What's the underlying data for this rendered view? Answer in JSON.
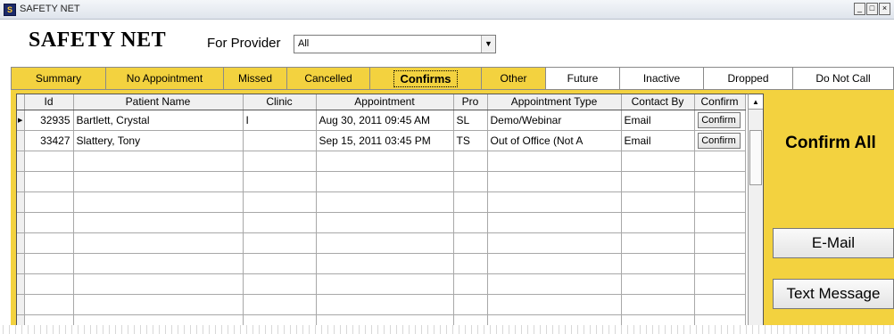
{
  "window": {
    "title": "SAFETY NET",
    "controls": [
      "_",
      "□",
      "×"
    ]
  },
  "header": {
    "app_title": "SAFETY NET",
    "provider_label": "For Provider",
    "provider_value": "All"
  },
  "tabs": [
    {
      "label": "Summary",
      "style": "yellow"
    },
    {
      "label": "No Appointment",
      "style": "yellow"
    },
    {
      "label": "Missed",
      "style": "yellow"
    },
    {
      "label": "Cancelled",
      "style": "yellow"
    },
    {
      "label": "Confirms",
      "style": "active"
    },
    {
      "label": "Other",
      "style": "yellow"
    },
    {
      "label": "Future",
      "style": "white"
    },
    {
      "label": "Inactive",
      "style": "white"
    },
    {
      "label": "Dropped",
      "style": "white"
    },
    {
      "label": "Do Not Call",
      "style": "white"
    }
  ],
  "grid": {
    "columns": [
      "Id",
      "Patient Name",
      "Clinic",
      "Appointment",
      "Pro",
      "Appointment Type",
      "Contact By",
      "Confirm"
    ],
    "rows": [
      {
        "id": "32935",
        "patient": "Bartlett, Crystal",
        "clinic": "I",
        "appointment": "Aug 30, 2011 09:45 AM",
        "pro": "SL",
        "type": "Demo/Webinar",
        "contact": "Email",
        "confirm": "Confirm"
      },
      {
        "id": "33427",
        "patient": "Slattery, Tony",
        "clinic": "",
        "appointment": "Sep 15, 2011 03:45 PM",
        "pro": "TS",
        "type": "Out of Office (Not A",
        "contact": "Email",
        "confirm": "Confirm"
      }
    ]
  },
  "actions": {
    "confirm_all": "Confirm All",
    "email": "E-Mail",
    "text_message": "Text Message"
  },
  "colors": {
    "accent_yellow": "#f3d23f"
  }
}
